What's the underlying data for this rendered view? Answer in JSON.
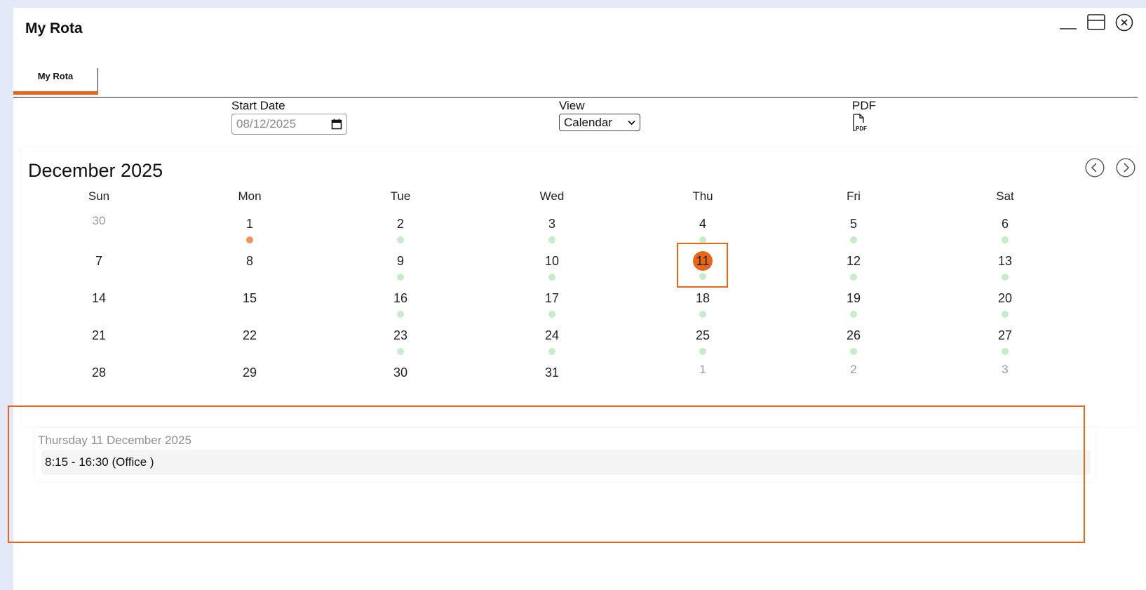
{
  "window": {
    "title": "My Rota"
  },
  "tabs": [
    {
      "label": "My Rota",
      "active": true
    }
  ],
  "controls": {
    "start_date_label": "Start Date",
    "start_date_value": "08/12/2025",
    "view_label": "View",
    "view_value": "Calendar",
    "pdf_label": "PDF"
  },
  "calendar": {
    "month_title": "December 2025",
    "weekdays": [
      "Sun",
      "Mon",
      "Tue",
      "Wed",
      "Thu",
      "Fri",
      "Sat"
    ],
    "weeks": [
      [
        {
          "d": "30",
          "other": true,
          "dot": "none"
        },
        {
          "d": "1",
          "dot": "orange"
        },
        {
          "d": "2",
          "dot": "green"
        },
        {
          "d": "3",
          "dot": "green"
        },
        {
          "d": "4",
          "dot": "green"
        },
        {
          "d": "5",
          "dot": "green"
        },
        {
          "d": "6",
          "dot": "green"
        }
      ],
      [
        {
          "d": "7",
          "dot": "none"
        },
        {
          "d": "8",
          "dot": "none"
        },
        {
          "d": "9",
          "dot": "green"
        },
        {
          "d": "10",
          "dot": "green"
        },
        {
          "d": "11",
          "dot": "green",
          "selected": true
        },
        {
          "d": "12",
          "dot": "green"
        },
        {
          "d": "13",
          "dot": "green"
        }
      ],
      [
        {
          "d": "14",
          "dot": "none"
        },
        {
          "d": "15",
          "dot": "none"
        },
        {
          "d": "16",
          "dot": "green"
        },
        {
          "d": "17",
          "dot": "green"
        },
        {
          "d": "18",
          "dot": "green"
        },
        {
          "d": "19",
          "dot": "green"
        },
        {
          "d": "20",
          "dot": "green"
        }
      ],
      [
        {
          "d": "21",
          "dot": "none"
        },
        {
          "d": "22",
          "dot": "none"
        },
        {
          "d": "23",
          "dot": "green"
        },
        {
          "d": "24",
          "dot": "green"
        },
        {
          "d": "25",
          "dot": "green"
        },
        {
          "d": "26",
          "dot": "green"
        },
        {
          "d": "27",
          "dot": "green"
        }
      ],
      [
        {
          "d": "28",
          "dot": "none"
        },
        {
          "d": "29",
          "dot": "none"
        },
        {
          "d": "30",
          "dot": "none"
        },
        {
          "d": "31",
          "dot": "none"
        },
        {
          "d": "1",
          "other": true,
          "dot": "none"
        },
        {
          "d": "2",
          "other": true,
          "dot": "none"
        },
        {
          "d": "3",
          "other": true,
          "dot": "none"
        }
      ]
    ]
  },
  "detail": {
    "date_heading": "Thursday 11 December 2025",
    "shifts": [
      "8:15 - 16:30 (Office )"
    ]
  },
  "colors": {
    "accent": "#e8661a",
    "dot_green": "#c6ecc8",
    "dot_orange": "#f0955a"
  },
  "icons": [
    "minimize-icon",
    "maximize-icon",
    "close-icon",
    "calendar-icon",
    "chevron-down-icon",
    "pdf-file-icon",
    "prev-month-icon",
    "next-month-icon"
  ]
}
